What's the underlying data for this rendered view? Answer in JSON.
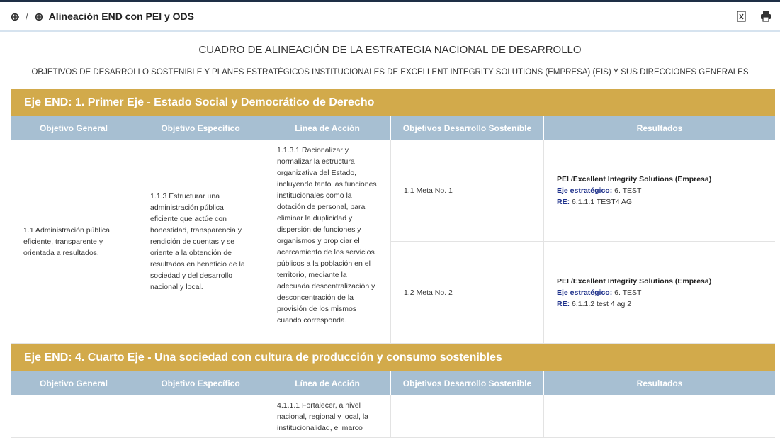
{
  "header": {
    "breadcrumb_sep": "/",
    "title": "Alineación END con PEI y ODS",
    "icons": [
      "move-icon",
      "move-icon",
      "excel-icon",
      "print-icon"
    ]
  },
  "report": {
    "title": "CUADRO DE ALINEACIÓN DE LA ESTRATEGIA NACIONAL DE DESARROLLO",
    "subtitle": "OBJETIVOS DE DESARROLLO SOSTENIBLE Y PLANES ESTRATÉGICOS INSTITUCIONALES DE EXCELLENT INTEGRITY SOLUTIONS (EMPRESA) (EIS) Y SUS DIRECCIONES GENERALES"
  },
  "columns": [
    "Objetivo General",
    "Objetivo Específico",
    "Línea de Acción",
    "Objetivos Desarrollo Sostenible",
    "Resultados"
  ],
  "sections": [
    {
      "axis": "Eje END: 1. Primer Eje - Estado Social y Democrático de Derecho",
      "objetivo_general": "1.1 Administración pública eficiente, transparente y orientada a resultados.",
      "objetivo_especifico": "1.1.3 Estructurar una administración pública eficiente que actúe con honestidad, transparencia y rendición de cuentas y se oriente a la obtención de resultados en beneficio de la sociedad y del desarrollo nacional y local.",
      "linea_accion": "1.1.3.1 Racionalizar y normalizar la estructura organizativa del Estado, incluyendo tanto las funciones institucionales como la dotación de personal, para eliminar la duplicidad y dispersión de funciones y organismos y propiciar el acercamiento de los servicios públicos a la población en el territorio, mediante la adecuada descentralización y desconcentración de la provisión de los mismos cuando corresponda.",
      "rows": [
        {
          "ods": "1.1 Meta No. 1",
          "pei": "PEI /Excellent Integrity Solutions (Empresa)",
          "eje_label": "Eje estratégico:",
          "eje_value": "6. TEST",
          "re_label": "RE:",
          "re_value": "6.1.1.1 TEST4 AG"
        },
        {
          "ods": "1.2 Meta No. 2",
          "pei": "PEI /Excellent Integrity Solutions (Empresa)",
          "eje_label": "Eje estratégico:",
          "eje_value": "6. TEST",
          "re_label": "RE:",
          "re_value": "6.1.1.2 test 4 ag 2"
        }
      ]
    },
    {
      "axis": "Eje END: 4. Cuarto Eje - Una sociedad con cultura de producción y consumo sostenibles",
      "linea_accion": "4.1.1.1 Fortalecer, a nivel nacional, regional y local, la institucionalidad, el marco"
    }
  ]
}
